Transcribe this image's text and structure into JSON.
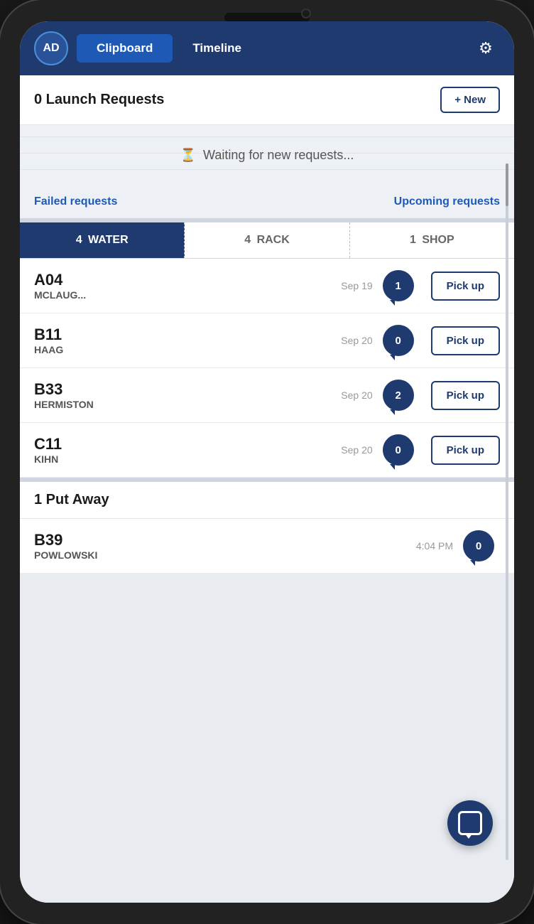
{
  "header": {
    "avatar_text": "AD",
    "tab_clipboard": "Clipboard",
    "tab_timeline": "Timeline",
    "active_tab": "clipboard"
  },
  "launch_requests": {
    "title": "0 Launch Requests",
    "new_button": "+ New",
    "waiting_icon": "⏳",
    "waiting_text": "Waiting for new requests...",
    "failed_link": "Failed requests",
    "upcoming_link": "Upcoming requests"
  },
  "category_tabs": [
    {
      "count": "4",
      "label": "WATER",
      "active": true
    },
    {
      "count": "4",
      "label": "RACK",
      "active": false
    },
    {
      "count": "1",
      "label": "SHOP",
      "active": false
    }
  ],
  "water_items": [
    {
      "code": "A04",
      "name": "MCLAUG...",
      "date": "Sep 19",
      "comments": "1",
      "button": "Pick up"
    },
    {
      "code": "B11",
      "name": "HAAG",
      "date": "Sep 20",
      "comments": "0",
      "button": "Pick up"
    },
    {
      "code": "B33",
      "name": "HERMISTON",
      "date": "Sep 20",
      "comments": "2",
      "button": "Pick up"
    },
    {
      "code": "C11",
      "name": "KIHN",
      "date": "Sep 20",
      "comments": "0",
      "button": "Pick up"
    }
  ],
  "put_away": {
    "title": "1 Put Away",
    "items": [
      {
        "code": "B39",
        "name": "POWLOWSKI",
        "date": "4:04 PM",
        "comments": "0"
      }
    ]
  }
}
